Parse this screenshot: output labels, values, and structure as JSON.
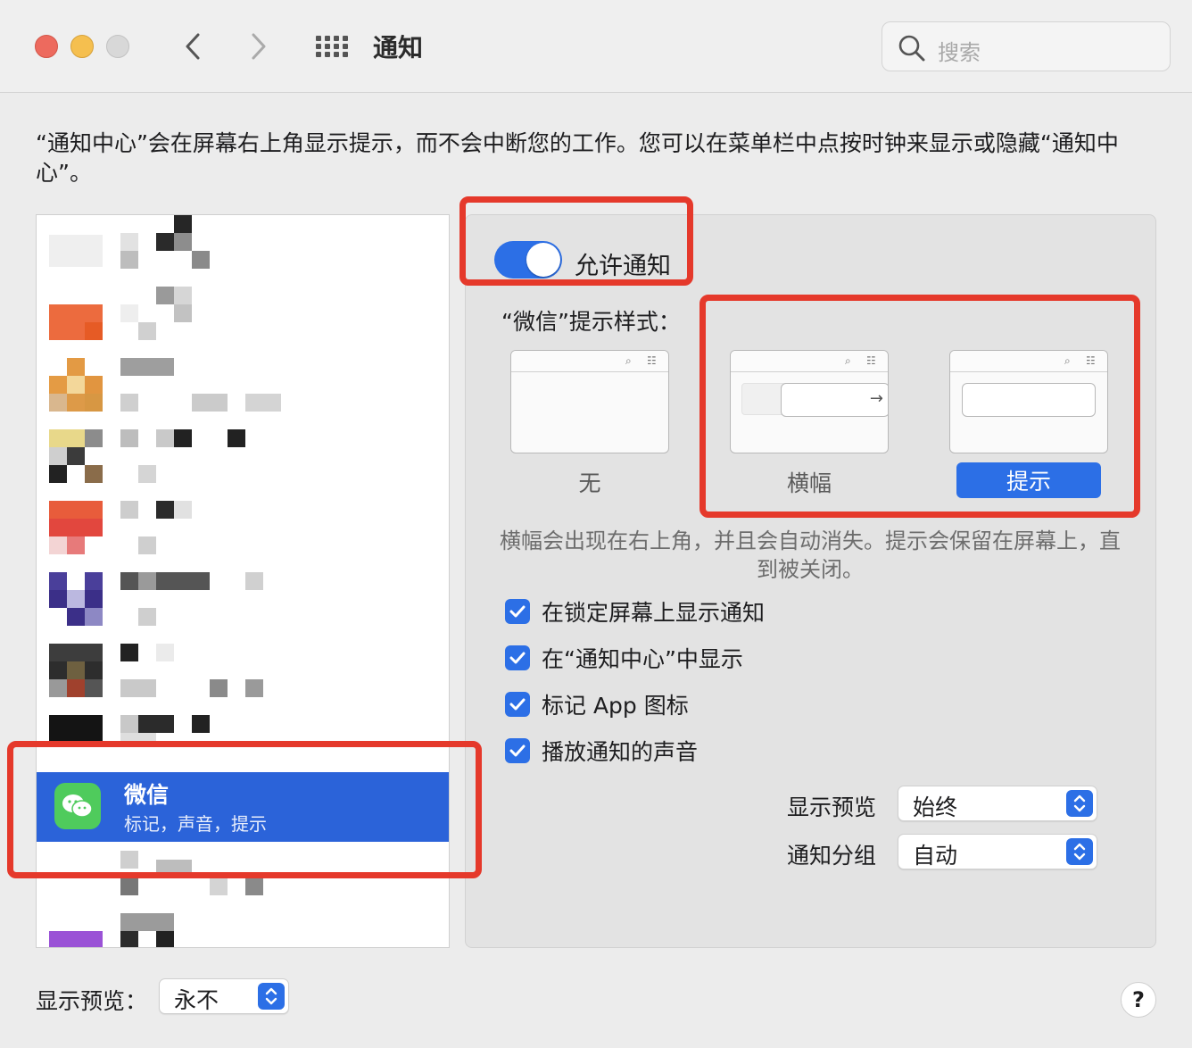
{
  "window": {
    "title": "通知"
  },
  "search": {
    "placeholder": "搜索"
  },
  "intro_text": "“通知中心”会在屏幕右上角显示提示，而不会中断您的工作。您可以在菜单栏中点按时钟来显示或隐藏“通知中心”。",
  "app_list": {
    "selected": {
      "name": "微信",
      "subtitle": "标记，声音，提示"
    }
  },
  "settings": {
    "allow_label": "允许通知",
    "allow_on": true,
    "style_label": "“微信”提示样式：",
    "styles": [
      {
        "label": "无"
      },
      {
        "label": "横幅"
      },
      {
        "label": "提示",
        "selected": true
      }
    ],
    "description": "横幅会出现在右上角，并且会自动消失。提示会保留在屏幕上，直到被关闭。",
    "checkboxes": [
      {
        "label": "在锁定屏幕上显示通知",
        "checked": true
      },
      {
        "label": "在“通知中心”中显示",
        "checked": true
      },
      {
        "label": "标记 App 图标",
        "checked": true
      },
      {
        "label": "播放通知的声音",
        "checked": true
      }
    ],
    "show_preview": {
      "label": "显示预览",
      "value": "始终"
    },
    "grouping": {
      "label": "通知分组",
      "value": "自动"
    }
  },
  "footer": {
    "show_preview_label": "显示预览：",
    "show_preview_value": "永不",
    "help": "?"
  },
  "colors": {
    "accent": "#2c6fe6",
    "selection": "#2b63d9",
    "highlight": "#e5392b",
    "wechat": "#4fcb5c"
  }
}
